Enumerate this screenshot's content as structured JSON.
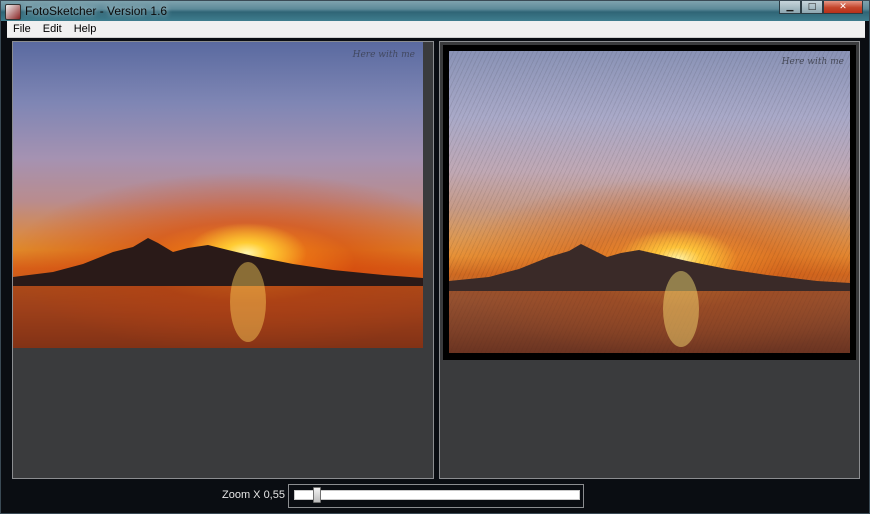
{
  "window": {
    "title": "FotoSketcher - Version 1.6",
    "icon": "fotosketcher-app-icon",
    "controls": [
      "minimize-icon",
      "maximize-icon",
      "close-icon"
    ]
  },
  "menu": {
    "items": [
      {
        "label": "File"
      },
      {
        "label": "Edit"
      },
      {
        "label": "Help"
      }
    ]
  },
  "panels": {
    "original": {
      "content": "sunset-over-water-photo",
      "watermark": "Here with me"
    },
    "sketch": {
      "content": "pencil-sketch-of-sunset",
      "watermark": "Here with me"
    }
  },
  "zoom": {
    "label": "Zoom X 0,55",
    "slider_value": 0.07
  },
  "colors": {
    "background": "#0a0d12",
    "panel": "#3a3b3d",
    "titlebar": "#3f7d8e"
  }
}
